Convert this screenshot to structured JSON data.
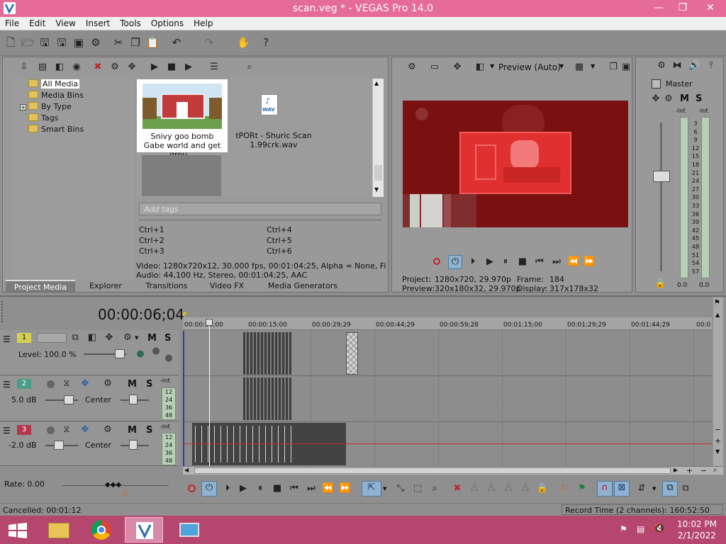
{
  "window": {
    "title": "scan.veg * - VEGAS Pro 14.0",
    "minimize": "—",
    "restore": "❒",
    "close": "✕"
  },
  "menu": [
    "File",
    "Edit",
    "View",
    "Insert",
    "Tools",
    "Options",
    "Help"
  ],
  "project_media": {
    "tree": [
      "All Media",
      "Media Bins",
      "By Type",
      "Tags",
      "Smart Bins"
    ],
    "expander": "+",
    "items": [
      {
        "caption": "Snivy goo bomb Gabe world and get grou…"
      },
      {
        "caption": "tPORt - Shuric Scan 1.99crk.wav",
        "badge": "WAV"
      }
    ],
    "tags_placeholder": "Add tags",
    "shortcuts": [
      "Ctrl+1",
      "Ctrl+2",
      "Ctrl+3",
      "Ctrl+4",
      "Ctrl+5",
      "Ctrl+6"
    ],
    "info_video": "Video: 1280x720x12, 30.000 fps, 00:01:04;25, Alpha = None, Field Orde",
    "info_audio": "Audio: 44,100 Hz, Stereo, 00:01:04;25, AAC"
  },
  "tabs": [
    "Project Media",
    "Explorer",
    "Transitions",
    "Video FX",
    "Media Generators"
  ],
  "preview": {
    "mode": "Preview (Auto)",
    "project_label": "Project:",
    "project_value": "1280x720, 29.970p",
    "preview_label": "Preview:",
    "preview_value": "320x180x32, 29.970p",
    "frame_label": "Frame:",
    "frame_value": "184",
    "display_label": "Display:",
    "display_value": "317x178x32"
  },
  "master": {
    "label": "Master",
    "mute": "M",
    "solo": "S",
    "inf_left": "-Inf.",
    "inf_right": "-Inf.",
    "scale": [
      "3",
      "6",
      "9",
      "12",
      "15",
      "18",
      "21",
      "24",
      "27",
      "30",
      "33",
      "36",
      "39",
      "42",
      "45",
      "48",
      "51",
      "54",
      "57"
    ],
    "value_left": "0.0",
    "value_right": "0.0"
  },
  "timeline": {
    "timecode": "00:00:06;04",
    "ruler": [
      "00:00:00;00",
      "00:00:15:00",
      "00:00:29;29",
      "00:00:44;29",
      "00:00:59;28",
      "00:01:15;00",
      "00:01:29;29",
      "00:01:44;29",
      "00:0"
    ],
    "tracks": [
      {
        "num": "1",
        "mute": "M",
        "solo": "S",
        "level": "Level: 100.0 %"
      },
      {
        "num": "2",
        "mute": "M",
        "solo": "S",
        "vol": "5.0 dB",
        "pan": "Center",
        "inf": "-Inf.",
        "meter": [
          "12",
          "24",
          "36",
          "48"
        ]
      },
      {
        "num": "3",
        "mute": "M",
        "solo": "S",
        "vol": "-2.0 dB",
        "pan": "Center",
        "inf": "-Inf.",
        "meter": [
          "12",
          "24",
          "36",
          "48"
        ]
      }
    ],
    "rate": "Rate: 0.00"
  },
  "status": {
    "left": "Cancelled: 00:01:12",
    "right": "Record Time (2 channels): 160:52:50"
  },
  "taskbar": {
    "time": "10:02 PM",
    "date": "2/1/2022"
  },
  "colors": {
    "titlebar": "#e56b98",
    "taskbar": "#b5466e",
    "preview_bg": "#7a1010",
    "track1": "#d6cf55",
    "track2": "#4a9e87",
    "track3": "#b2384d"
  }
}
